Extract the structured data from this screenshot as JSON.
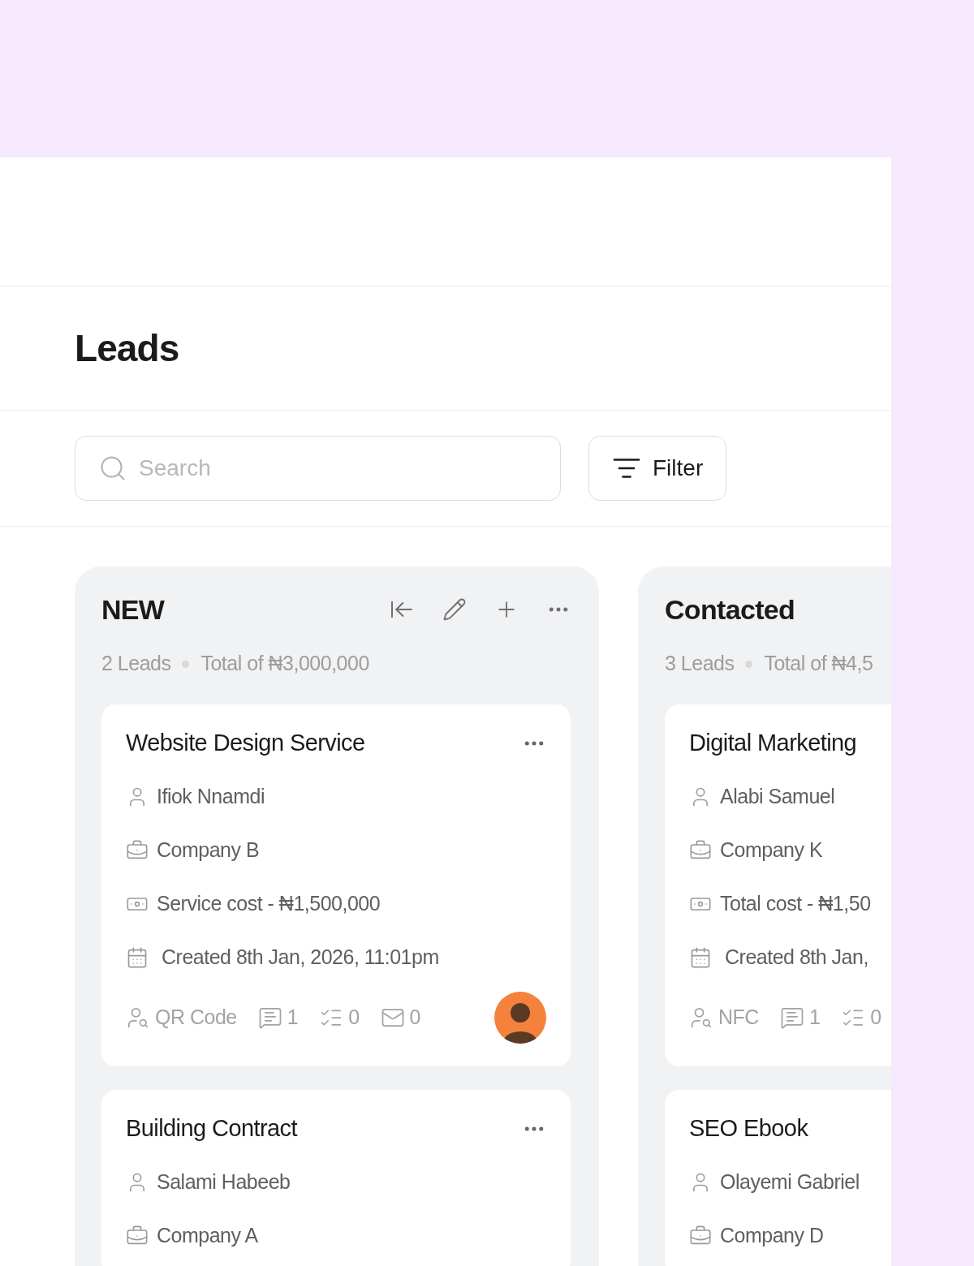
{
  "page": {
    "title": "Leads"
  },
  "search": {
    "placeholder": "Search"
  },
  "filter_button": {
    "label": "Filter"
  },
  "columns": [
    {
      "title": "NEW",
      "toolbar": true,
      "count": "2 Leads",
      "total": "Total of ₦3,000,000",
      "cards": [
        {
          "title": "Website Design Service",
          "menu": true,
          "avatar": true,
          "fields": [
            {
              "kind": "person",
              "text": "Ifiok Nnamdi"
            },
            {
              "kind": "company",
              "text": "Company B"
            },
            {
              "kind": "cost",
              "text": "Service cost - ₦1,500,000"
            },
            {
              "kind": "created",
              "text": "Created 8th Jan, 2026, 11:01pm"
            }
          ],
          "stats": [
            {
              "kind": "source",
              "text": "QR Code"
            },
            {
              "kind": "comments",
              "text": "1"
            },
            {
              "kind": "tasks",
              "text": "0"
            },
            {
              "kind": "emails",
              "text": "0"
            }
          ]
        },
        {
          "title": "Building Contract",
          "menu": true,
          "fields": [
            {
              "kind": "person",
              "text": "Salami Habeeb"
            },
            {
              "kind": "company",
              "text": "Company A"
            }
          ]
        }
      ]
    },
    {
      "title": "Contacted",
      "count": "3 Leads",
      "total": "Total of ₦4,5",
      "cards": [
        {
          "title": "Digital Marketing",
          "fields": [
            {
              "kind": "person",
              "text": "Alabi Samuel"
            },
            {
              "kind": "company",
              "text": "Company K"
            },
            {
              "kind": "cost",
              "text": "Total cost - ₦1,50"
            },
            {
              "kind": "created",
              "text": "Created 8th Jan,"
            }
          ],
          "stats": [
            {
              "kind": "source",
              "text": "NFC"
            },
            {
              "kind": "comments",
              "text": "1"
            },
            {
              "kind": "tasks",
              "text": "0"
            }
          ]
        },
        {
          "title": "SEO Ebook",
          "fields": [
            {
              "kind": "person",
              "text": "Olayemi Gabriel"
            },
            {
              "kind": "company",
              "text": "Company D"
            }
          ]
        }
      ]
    }
  ]
}
